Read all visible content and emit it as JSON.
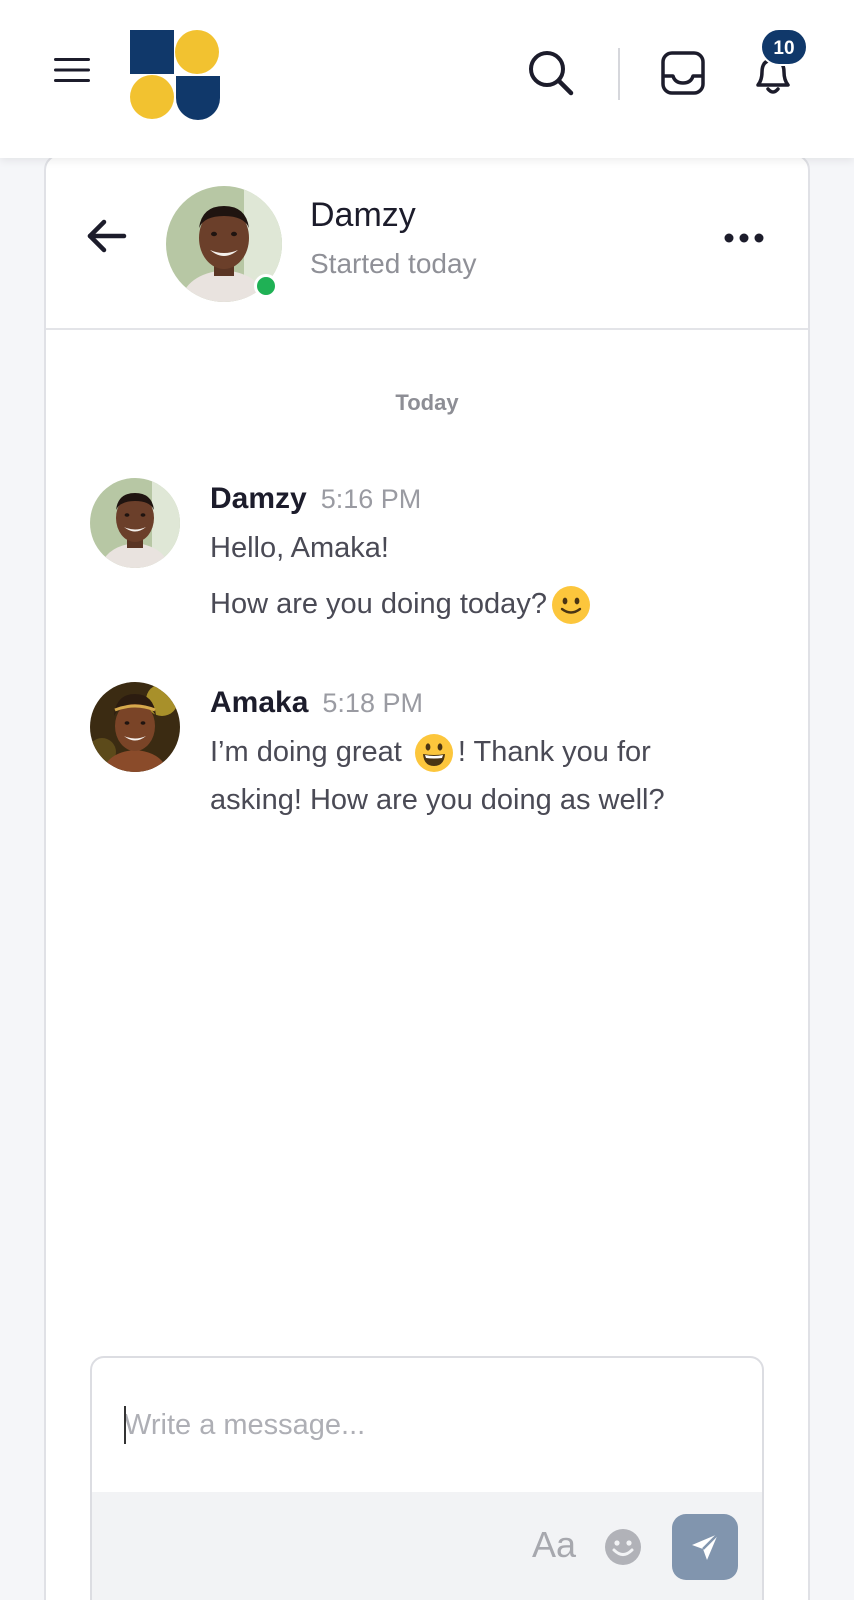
{
  "topbar": {
    "icons": [
      "hamburger-menu-icon",
      "logo",
      "search-icon",
      "inbox-icon",
      "bell-icon"
    ],
    "notification_count": "10",
    "colors": {
      "brand_navy": "#10386a",
      "brand_yellow": "#f2c230"
    }
  },
  "chat": {
    "contact_name": "Damzy",
    "contact_status": "Started today",
    "online_color": "#1fb155",
    "date_label": "Today",
    "messages": [
      {
        "sender": "Damzy",
        "time": "5:16 PM",
        "lines": [
          "Hello, Amaka!",
          "How are you doing today?"
        ],
        "emoji": "slightly-smiling-face"
      },
      {
        "sender": "Amaka",
        "time": "5:18 PM",
        "text_before_emoji": "I’m doing great",
        "emoji": "grinning-face",
        "text_after_emoji": "! Thank you for",
        "line2": "asking! How are you doing as well?"
      }
    ]
  },
  "composer": {
    "placeholder": "Write a message...",
    "format_label": "Aa",
    "send_color": "#8195ae"
  }
}
